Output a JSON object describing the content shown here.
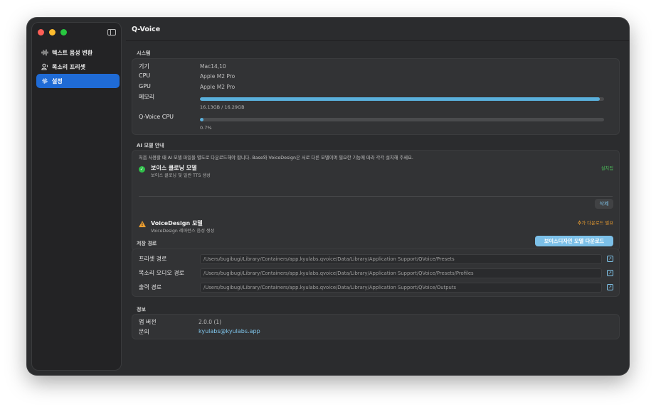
{
  "sidebar": {
    "items": [
      {
        "label": "텍스트 음성 변환",
        "icon": "waveform-icon"
      },
      {
        "label": "목소리 프리셋",
        "icon": "voice-preset-icon"
      },
      {
        "label": "설정",
        "icon": "gear-icon"
      }
    ],
    "active_index": 2
  },
  "header": {
    "title": "Q-Voice"
  },
  "system": {
    "section_label": "시스템",
    "device_label": "기기",
    "device_value": "Mac14,10",
    "cpu_label": "CPU",
    "cpu_value": "Apple M2 Pro",
    "gpu_label": "GPU",
    "gpu_value": "Apple M2 Pro",
    "memory_label": "메모리",
    "memory_usage": 0.99,
    "memory_text": "16.13GB / 16.29GB",
    "qvoice_cpu_label": "Q-Voice CPU",
    "qvoice_cpu_usage": 0.007,
    "qvoice_cpu_text": "0.7%"
  },
  "ai_models": {
    "section_label": "AI 모델 안내",
    "notice": "처음 사용할 때 AI 모델 파일을 별도로 다운로드해야 합니다. Base와 VoiceDesign은 서로 다른 모델이며 필요한 기능에 따라 각각 설치해 주세요.",
    "models": [
      {
        "name": "보이스 클로닝 모델",
        "description": "보이스 클로닝 및 일반 TTS 생성",
        "status": "설치됨",
        "action": "삭제"
      },
      {
        "name": "VoiceDesign 모델",
        "description": "VoiceDesign 레퍼런스 음성 생성",
        "status": "추가 다운로드 필요",
        "action": "보이스디자인 모델 다운로드"
      }
    ]
  },
  "storage": {
    "section_label": "저장 경로",
    "paths": [
      {
        "label": "프리셋 경로",
        "value": "/Users/bugibugi/Library/Containers/app.kyulabs.qvoice/Data/Library/Application Support/QVoice/Presets"
      },
      {
        "label": "목소리 오디오 경로",
        "value": "/Users/bugibugi/Library/Containers/app.kyulabs.qvoice/Data/Library/Application Support/QVoice/Presets/Profiles"
      },
      {
        "label": "출력 경로",
        "value": "/Users/bugibugi/Library/Containers/app.kyulabs.qvoice/Data/Library/Application Support/QVoice/Outputs"
      }
    ]
  },
  "info": {
    "section_label": "정보",
    "version_label": "앱 버전",
    "version_value": "2.0.0 (1)",
    "contact_label": "문의",
    "contact_value": "kyulabs@kyulabs.app"
  },
  "colors": {
    "accent": "#1f6bd6",
    "link": "#7fc4ea",
    "progress": "#5ab0dc",
    "installed": "#4cc05a",
    "warning": "#f0a030"
  }
}
